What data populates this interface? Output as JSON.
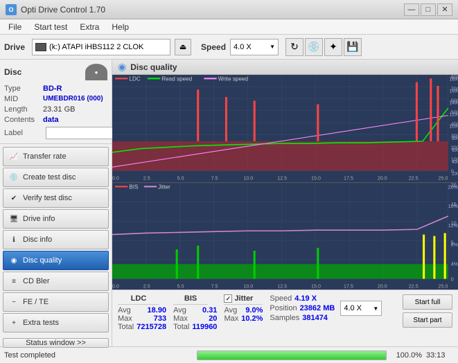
{
  "titleBar": {
    "title": "Opti Drive Control 1.70",
    "minBtn": "—",
    "maxBtn": "□",
    "closeBtn": "✕"
  },
  "menuBar": {
    "items": [
      "File",
      "Start test",
      "Extra",
      "Help"
    ]
  },
  "toolbar": {
    "driveLabel": "Drive",
    "driveValue": "(k:) ATAPI iHBS112  2 CLOK",
    "speedLabel": "Speed",
    "speedValue": "4.0 X"
  },
  "discInfo": {
    "sectionLabel": "Disc",
    "typeLabel": "Type",
    "typeValue": "BD-R",
    "midLabel": "MID",
    "midValue": "UMEBDR016 (000)",
    "lengthLabel": "Length",
    "lengthValue": "23.31 GB",
    "contentsLabel": "Contents",
    "contentsValue": "data",
    "labelLabel": "Label"
  },
  "navItems": [
    {
      "id": "transfer-rate",
      "label": "Transfer rate",
      "active": false
    },
    {
      "id": "create-test-disc",
      "label": "Create test disc",
      "active": false
    },
    {
      "id": "verify-test-disc",
      "label": "Verify test disc",
      "active": false
    },
    {
      "id": "drive-info",
      "label": "Drive info",
      "active": false
    },
    {
      "id": "disc-info",
      "label": "Disc info",
      "active": false
    },
    {
      "id": "disc-quality",
      "label": "Disc quality",
      "active": true
    },
    {
      "id": "cd-bler",
      "label": "CD Bler",
      "active": false
    },
    {
      "id": "fe-te",
      "label": "FE / TE",
      "active": false
    },
    {
      "id": "extra-tests",
      "label": "Extra tests",
      "active": false
    }
  ],
  "statusWindowBtn": "Status window >>",
  "panelHeader": "Disc quality",
  "topChart": {
    "legend": [
      {
        "label": "LDC",
        "color": "#ff4444"
      },
      {
        "label": "Read speed",
        "color": "#00ff00"
      },
      {
        "label": "Write speed",
        "color": "#ff88ff"
      }
    ],
    "yMax": 800,
    "xMax": 25,
    "rightLabels": [
      "18X",
      "16X",
      "14X",
      "12X",
      "10X",
      "8X",
      "6X",
      "4X",
      "2X"
    ]
  },
  "bottomChart": {
    "legend": [
      {
        "label": "BIS",
        "color": "#ff4444"
      },
      {
        "label": "Jitter",
        "color": "#888888"
      }
    ],
    "yMax": 20,
    "xMax": 25,
    "rightLabels": [
      "20%",
      "16%",
      "12%",
      "8%",
      "4%"
    ]
  },
  "stats": {
    "ldcLabel": "LDC",
    "bisLabel": "BIS",
    "jitterLabel": "Jitter",
    "jitterChecked": true,
    "avgLabel": "Avg",
    "maxLabel": "Max",
    "totalLabel": "Total",
    "ldcAvg": "18.90",
    "ldcMax": "733",
    "ldcTotal": "7215728",
    "bisAvg": "0.31",
    "bisMax": "20",
    "bisTotal": "119960",
    "jitterAvg": "9.0%",
    "jitterMax": "10.2%",
    "speedLabel": "Speed",
    "speedValue": "4.19 X",
    "speedSelectValue": "4.0 X",
    "positionLabel": "Position",
    "positionValue": "23862 MB",
    "samplesLabel": "Samples",
    "samplesValue": "381474",
    "startFullBtn": "Start full",
    "startPartBtn": "Start part"
  },
  "statusBar": {
    "statusText": "Test completed",
    "progressValue": 100,
    "progressLabel": "100.0%",
    "timeLabel": "33:13"
  }
}
